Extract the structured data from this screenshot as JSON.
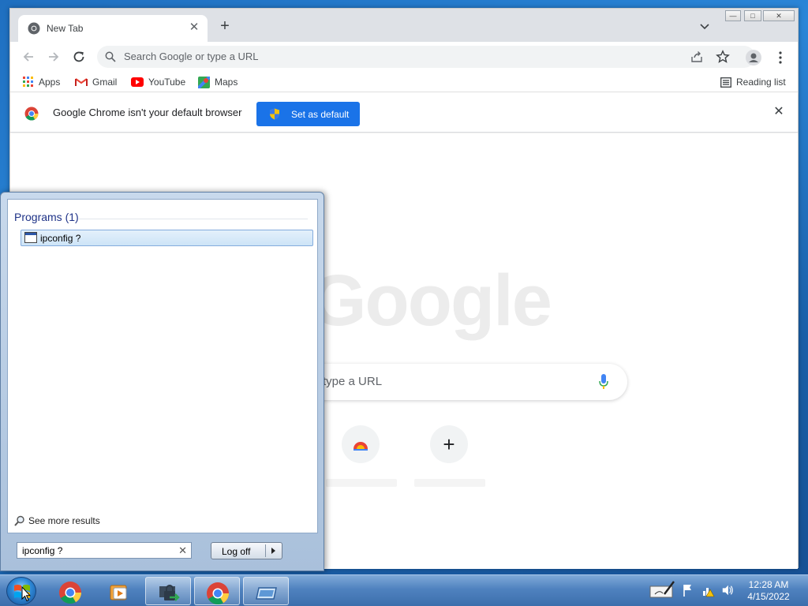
{
  "chrome": {
    "tab": {
      "title": "New Tab",
      "close": "✕"
    },
    "new_tab_symbol": "+",
    "omnibox": {
      "placeholder": "Search Google or type a URL"
    },
    "bookmarks": [
      {
        "label": "Apps",
        "icon": "apps-grid-icon"
      },
      {
        "label": "Gmail",
        "icon": "gmail-icon"
      },
      {
        "label": "YouTube",
        "icon": "youtube-icon"
      },
      {
        "label": "Maps",
        "icon": "maps-icon"
      }
    ],
    "reading_list": "Reading list",
    "infobar": {
      "message": "Google Chrome isn't your default browser",
      "button": "Set as default",
      "close": "✕"
    },
    "ntp": {
      "logo": "Google",
      "search_placeholder": "type a URL",
      "add_shortcut_symbol": "+"
    }
  },
  "start_menu": {
    "programs_header": "Programs (1)",
    "result": "ipconfig ?",
    "see_more": "See more results",
    "search_value": "ipconfig ?",
    "clear_symbol": "✕",
    "logoff": "Log off"
  },
  "taskbar": {
    "time": "12:28 AM",
    "date": "4/15/2022",
    "pinned": [
      "chrome-icon",
      "media-player-icon",
      "vpn-lock-icon",
      "chrome-icon",
      "window-icon"
    ]
  },
  "colors": {
    "accent": "#1a73e8",
    "taskbar": "#4f82bf"
  }
}
